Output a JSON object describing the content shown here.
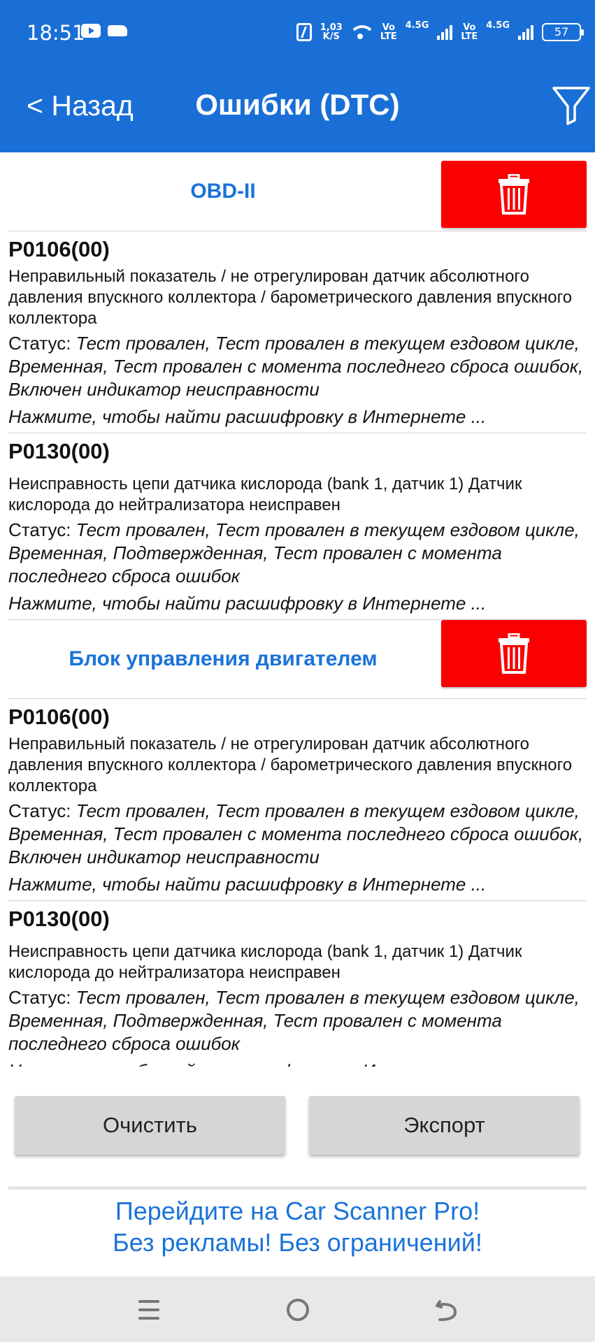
{
  "status_bar": {
    "time": "18:51",
    "speed_value": "1,03",
    "speed_unit": "K/S",
    "volte1_top": "Vo",
    "volte1_bottom": "LTE",
    "net1": "4.5G",
    "volte2_top": "Vo",
    "volte2_bottom": "LTE",
    "net2": "4.5G",
    "battery": "57",
    "icons": [
      "youtube-icon",
      "car-icon",
      "nfc-icon",
      "wifi-icon",
      "signal-icon",
      "battery-icon"
    ]
  },
  "header": {
    "back_label": "< Назад",
    "title": "Ошибки (DTC)",
    "filter_icon": "filter-icon",
    "background": "#1a6fd6"
  },
  "sections": [
    {
      "title": "OBD-II",
      "items": [
        {
          "code": "P0106(00)",
          "description": "Неправильный показатель / не отрегулирован датчик абсолютного давления впускного коллектора / барометрического давления впускного коллектора",
          "status_label": "Статус: ",
          "status_value": "Тест провален, Тест провален в текущем ездовом цикле, Временная, Тест провален с момента последнего сброса ошибок, Включен индикатор неисправности",
          "link": "Нажмите, чтобы найти расшифровку в Интернете ..."
        },
        {
          "code": "P0130(00)",
          "description": "Неисправность цепи датчика кислорода (bank 1, датчик 1) Датчик кислорода до нейтрализатора неисправен",
          "status_label": "Статус: ",
          "status_value": "Тест провален, Тест провален в текущем ездовом цикле, Временная, Подтвержденная, Тест провален с момента последнего сброса ошибок",
          "link": "Нажмите, чтобы найти расшифровку в Интернете ..."
        }
      ]
    },
    {
      "title": "Блок управления двигателем",
      "items": [
        {
          "code": "P0106(00)",
          "description": "Неправильный показатель / не отрегулирован датчик абсолютного давления впускного коллектора / барометрического давления впускного коллектора",
          "status_label": "Статус: ",
          "status_value": "Тест провален, Тест провален в текущем ездовом цикле, Временная, Тест провален с момента последнего сброса ошибок, Включен индикатор неисправности",
          "link": "Нажмите, чтобы найти расшифровку в Интернете ..."
        },
        {
          "code": "P0130(00)",
          "description": "Неисправность цепи датчика кислорода (bank 1, датчик 1) Датчик кислорода до нейтрализатора неисправен",
          "status_label": "Статус: ",
          "status_value": "Тест провален, Тест провален в текущем ездовом цикле, Временная, Подтвержденная, Тест провален с момента последнего сброса ошибок",
          "link": "Нажмите, чтобы найти расшифровку в Интернете ..."
        }
      ]
    }
  ],
  "actions": {
    "clear_label": "Очистить",
    "export_label": "Экспорт"
  },
  "promo": {
    "line1": "Перейдите на Car Scanner Pro!",
    "line2": "Без рекламы! Без ограничений!"
  },
  "nav_bar": {
    "icons": [
      "menu-icon",
      "home-icon",
      "back-icon"
    ]
  },
  "colors": {
    "accent": "#1a6fd6",
    "link_blue": "#1a73d9",
    "delete_red": "#fb0000",
    "button_gray": "#d6d6d6"
  }
}
